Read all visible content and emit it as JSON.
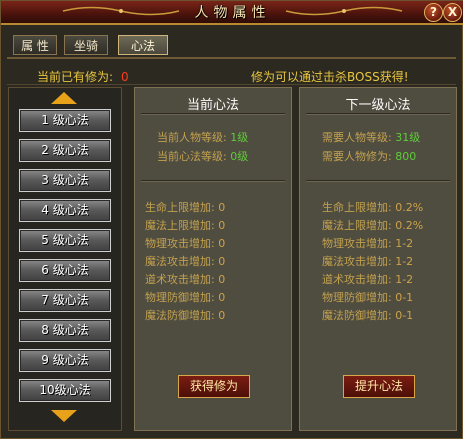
{
  "window": {
    "title": "人物属性",
    "help_label": "?",
    "close_label": "X"
  },
  "tabs": [
    {
      "label": "属 性",
      "active": false
    },
    {
      "label": "坐骑",
      "active": false
    },
    {
      "label": "心法",
      "active": true
    }
  ],
  "info": {
    "cultivation_label": "当前已有修为:",
    "cultivation_value": "0",
    "hint": "修为可以通过击杀BOSS获得!"
  },
  "levels": [
    "1 级心法",
    "2 级心法",
    "3 级心法",
    "4 级心法",
    "5 级心法",
    "6 级心法",
    "7 级心法",
    "8 级心法",
    "9 级心法",
    "10级心法"
  ],
  "current": {
    "header": "当前心法",
    "req": [
      {
        "label": "当前人物等级:",
        "value": "1级"
      },
      {
        "label": "当前心法等级:",
        "value": "0级"
      }
    ],
    "stats": [
      {
        "label": "生命上限增加:",
        "value": "0"
      },
      {
        "label": "魔法上限增加:",
        "value": "0"
      },
      {
        "label": "物理攻击增加:",
        "value": "0"
      },
      {
        "label": "魔法攻击增加:",
        "value": "0"
      },
      {
        "label": "道术攻击增加:",
        "value": "0"
      },
      {
        "label": "物理防御增加:",
        "value": "0"
      },
      {
        "label": "魔法防御增加:",
        "value": "0"
      }
    ],
    "button": "获得修为"
  },
  "next": {
    "header": "下一级心法",
    "req": [
      {
        "label": "需要人物等级:",
        "value": "31级"
      },
      {
        "label": "需要人物修为:",
        "value": "800"
      }
    ],
    "stats": [
      {
        "label": "生命上限增加:",
        "value": "0.2%"
      },
      {
        "label": "魔法上限增加:",
        "value": "0.2%"
      },
      {
        "label": "物理攻击增加:",
        "value": "1-2"
      },
      {
        "label": "魔法攻击增加:",
        "value": "1-2"
      },
      {
        "label": "道术攻击增加:",
        "value": "1-2"
      },
      {
        "label": "物理防御增加:",
        "value": "0-1"
      },
      {
        "label": "魔法防御增加:",
        "value": "0-1"
      }
    ],
    "button": "提升心法"
  },
  "colors": {
    "gold": "#e9c73f",
    "value_red": "#ff3b1c",
    "value_green": "#5fcc3a",
    "panel": "#4f4c40"
  },
  "icons": {
    "scroll_up": "arrow-up-icon",
    "scroll_down": "arrow-down-icon"
  }
}
